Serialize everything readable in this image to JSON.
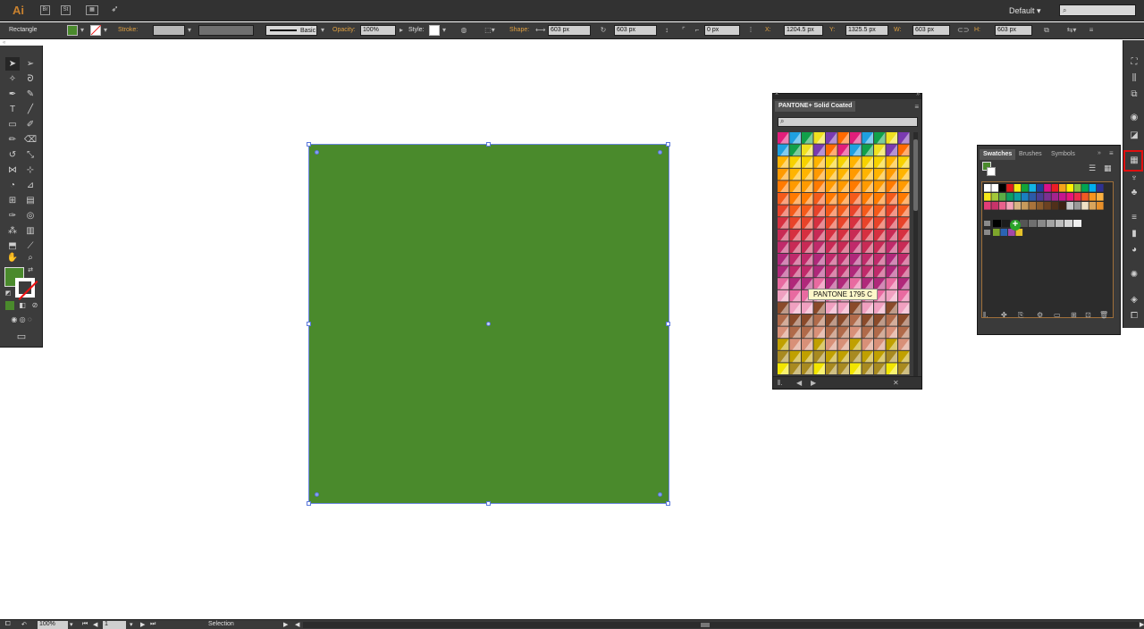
{
  "app": {
    "logo": "Ai",
    "buttons": [
      "Br",
      "St"
    ],
    "workspace": "Default",
    "workspace_arrow": "▾",
    "search_icon": "search-icon"
  },
  "control_bar": {
    "selection_type": "Rectangle",
    "fill_color": "#4a8a2c",
    "stroke_label": "Stroke:",
    "brush_preset": "Basic",
    "opacity_label": "Opacity:",
    "opacity_value": "100%",
    "style_label": "Style:",
    "shape_label": "Shape:",
    "shape_width": "603 px",
    "shape_height": "603 px",
    "corner_radius": "0 px",
    "x_label": "X:",
    "x_value": "1204.5 px",
    "y_label": "Y:",
    "y_value": "1325.5 px",
    "w_label": "W:",
    "w_value": "603 px",
    "h_label": "H:",
    "h_value": "603 px"
  },
  "canvas": {
    "rectangle_fill": "#4a8a2c",
    "selection_color": "#5a78dc"
  },
  "pantone_panel": {
    "title": "PANTONE+ Solid Coated",
    "tooltip": "PANTONE 1795 C"
  },
  "swatches_panel": {
    "tabs": [
      "Swatches",
      "Brushes",
      "Symbols"
    ],
    "active_tab": "Swatches",
    "rows": [
      [
        "#ffffff",
        "#ffffff",
        "#000000",
        "#e11d1d",
        "#f7ec13",
        "#13a538",
        "#12b4e4",
        "#1d3f99",
        "#d8128a",
        "#ed1c24",
        "#f5a31a",
        "#fff200",
        "#8cc63f",
        "#00a651",
        "#00aeef",
        "#2e3192"
      ],
      [
        "#f7e81a",
        "#a3c73a",
        "#5bab46",
        "#0c9f62",
        "#0b9fa0",
        "#1a7fc1",
        "#2c5aa8",
        "#4b3d94",
        "#7a3191",
        "#a5238e",
        "#c5168e",
        "#e8157b",
        "#ed2a4b",
        "#f05a24",
        "#f7941d",
        "#fbb040"
      ],
      [
        "#e23d78",
        "#c8336a",
        "#e8618c",
        "#f4a3b8",
        "#d9b382",
        "#c79a5c",
        "#a9733b",
        "#8a5a2b",
        "#6c4221",
        "#50301a",
        "#3b2314",
        "#c8c8c8",
        "#9a9a9a",
        "#efe2c5",
        "#d9a55c",
        "#e8902a"
      ]
    ],
    "gray_row": [
      "#000000",
      "#1c1c1c",
      "#3a3a3a",
      "#555555",
      "#6f6f6f",
      "#898989",
      "#a3a3a3",
      "#bdbdbd",
      "#d7d7d7",
      "#f0f0f0"
    ],
    "group_row": [
      "#7da62c",
      "#2a64b4",
      "#a347a8",
      "#e5c12a"
    ]
  },
  "status_bar": {
    "zoom": "100%",
    "page": "1",
    "tool": "Selection"
  }
}
